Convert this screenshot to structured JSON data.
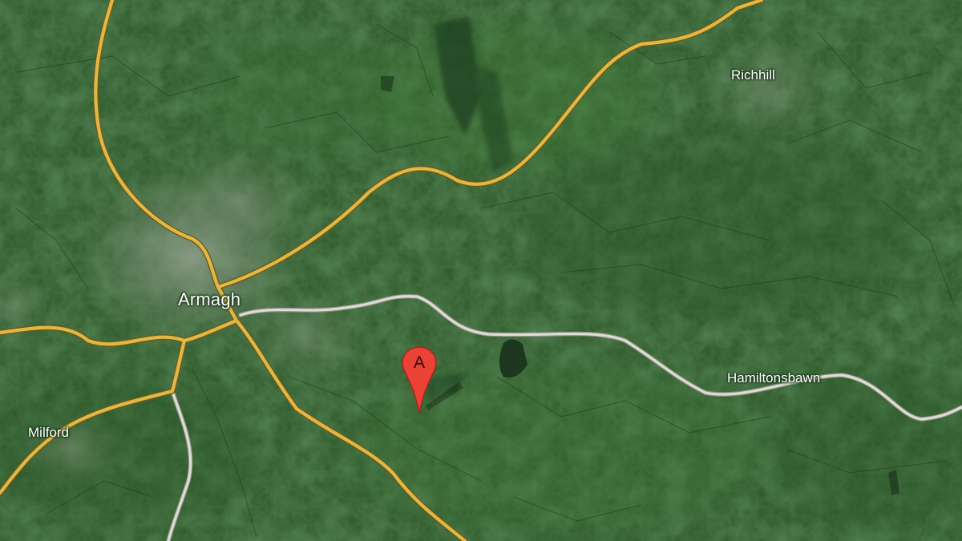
{
  "map": {
    "type": "satellite",
    "colors": {
      "land": "#2f5e2c",
      "major_road": "#d8b24a",
      "minor_road": "#d9d9cf",
      "water": "#1e3a22",
      "marker": "#ea4335"
    },
    "labels": {
      "armagh": "Armagh",
      "richhill": "Richhill",
      "milford": "Milford",
      "hamiltonsbawn": "Hamiltonsbawn"
    },
    "marker": {
      "letter": "A",
      "icon": "map-pin-icon"
    }
  }
}
